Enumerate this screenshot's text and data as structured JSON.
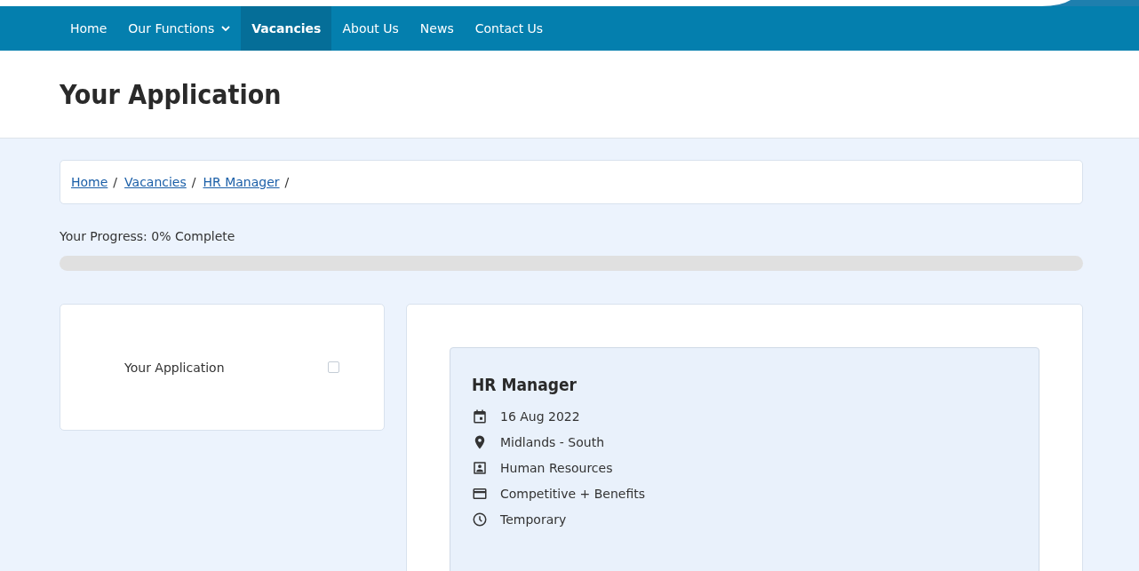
{
  "nav": {
    "items": [
      {
        "label": "Home",
        "selected": false,
        "dropdown": false
      },
      {
        "label": "Our Functions",
        "selected": false,
        "dropdown": true
      },
      {
        "label": "Vacancies",
        "selected": true,
        "dropdown": false
      },
      {
        "label": "About Us",
        "selected": false,
        "dropdown": false
      },
      {
        "label": "News",
        "selected": false,
        "dropdown": false
      },
      {
        "label": "Contact Us",
        "selected": false,
        "dropdown": false
      }
    ]
  },
  "page_title": "Your Application",
  "breadcrumbs": [
    {
      "label": "Home",
      "separator": "/"
    },
    {
      "label": "Vacancies",
      "separator": "/"
    },
    {
      "label": "HR Manager",
      "separator": "/"
    }
  ],
  "progress": {
    "label": "Your Progress: 0% Complete",
    "level": 0
  },
  "steps": [
    {
      "label": "Your Application",
      "checked": false
    }
  ],
  "job": {
    "title": "HR Manager",
    "details": [
      {
        "kind": "date",
        "text": "16 Aug 2022"
      },
      {
        "kind": "location",
        "text": "Midlands - South"
      },
      {
        "kind": "department",
        "text": "Human Resources"
      },
      {
        "kind": "salary",
        "text": "Competitive + Benefits"
      },
      {
        "kind": "contract",
        "text": "Temporary"
      }
    ]
  }
}
